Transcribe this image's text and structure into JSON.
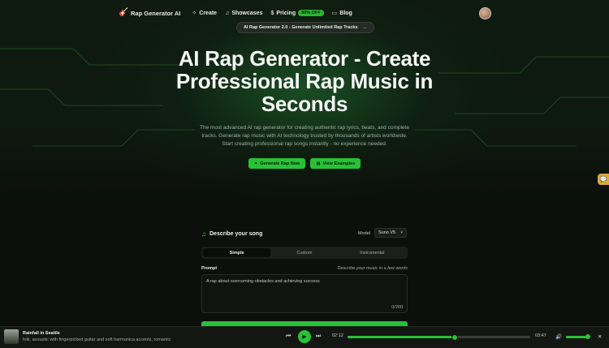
{
  "nav": {
    "brand": "Rap Generator AI",
    "items": [
      {
        "label": "Create",
        "icon": "magic-wand-icon"
      },
      {
        "label": "Showcases",
        "icon": "music-note-icon"
      },
      {
        "label": "Pricing",
        "icon": "dollar-icon",
        "badge": "50% OFF"
      },
      {
        "label": "Blog",
        "icon": "book-icon"
      }
    ]
  },
  "announcement": {
    "text": "AI Rap Generator 2.0 - Generate Unlimited Rap Tracks",
    "arrow": "→"
  },
  "hero": {
    "title": "AI Rap Generator - Create Professional Rap Music in Seconds",
    "subtitle": "The most advanced AI rap generator for creating authentic rap lyrics, beats, and complete tracks. Generate rap music with AI technology trusted by thousands of artists worldwide. Start creating professional rap songs instantly - no experience needed.",
    "primary_button": "Generate Rap Now",
    "secondary_button": "View Examples"
  },
  "composer": {
    "heading": "Describe your song",
    "model_label": "Model",
    "model_value": "Suno V5",
    "tabs": [
      "Simple",
      "Custom",
      "Instrumental"
    ],
    "active_tab": "Simple",
    "prompt_label": "Prompt",
    "prompt_hint": "Describe your music in a few words",
    "prompt_value": "A rap about overcoming obstacles and achieving success",
    "prompt_count": "0/200"
  },
  "player": {
    "title": "Rainfall in Seattle",
    "description": "folk, acoustic with fingerpicked guitar and soft harmonica accents, romantic",
    "current_time": "02:12",
    "duration": "03:47",
    "progress_fraction": 0.58,
    "volume_fraction": 0.9
  },
  "colors": {
    "accent": "#27c236",
    "background": "#0c0f0c",
    "chat_widget": "#d8a83a"
  }
}
